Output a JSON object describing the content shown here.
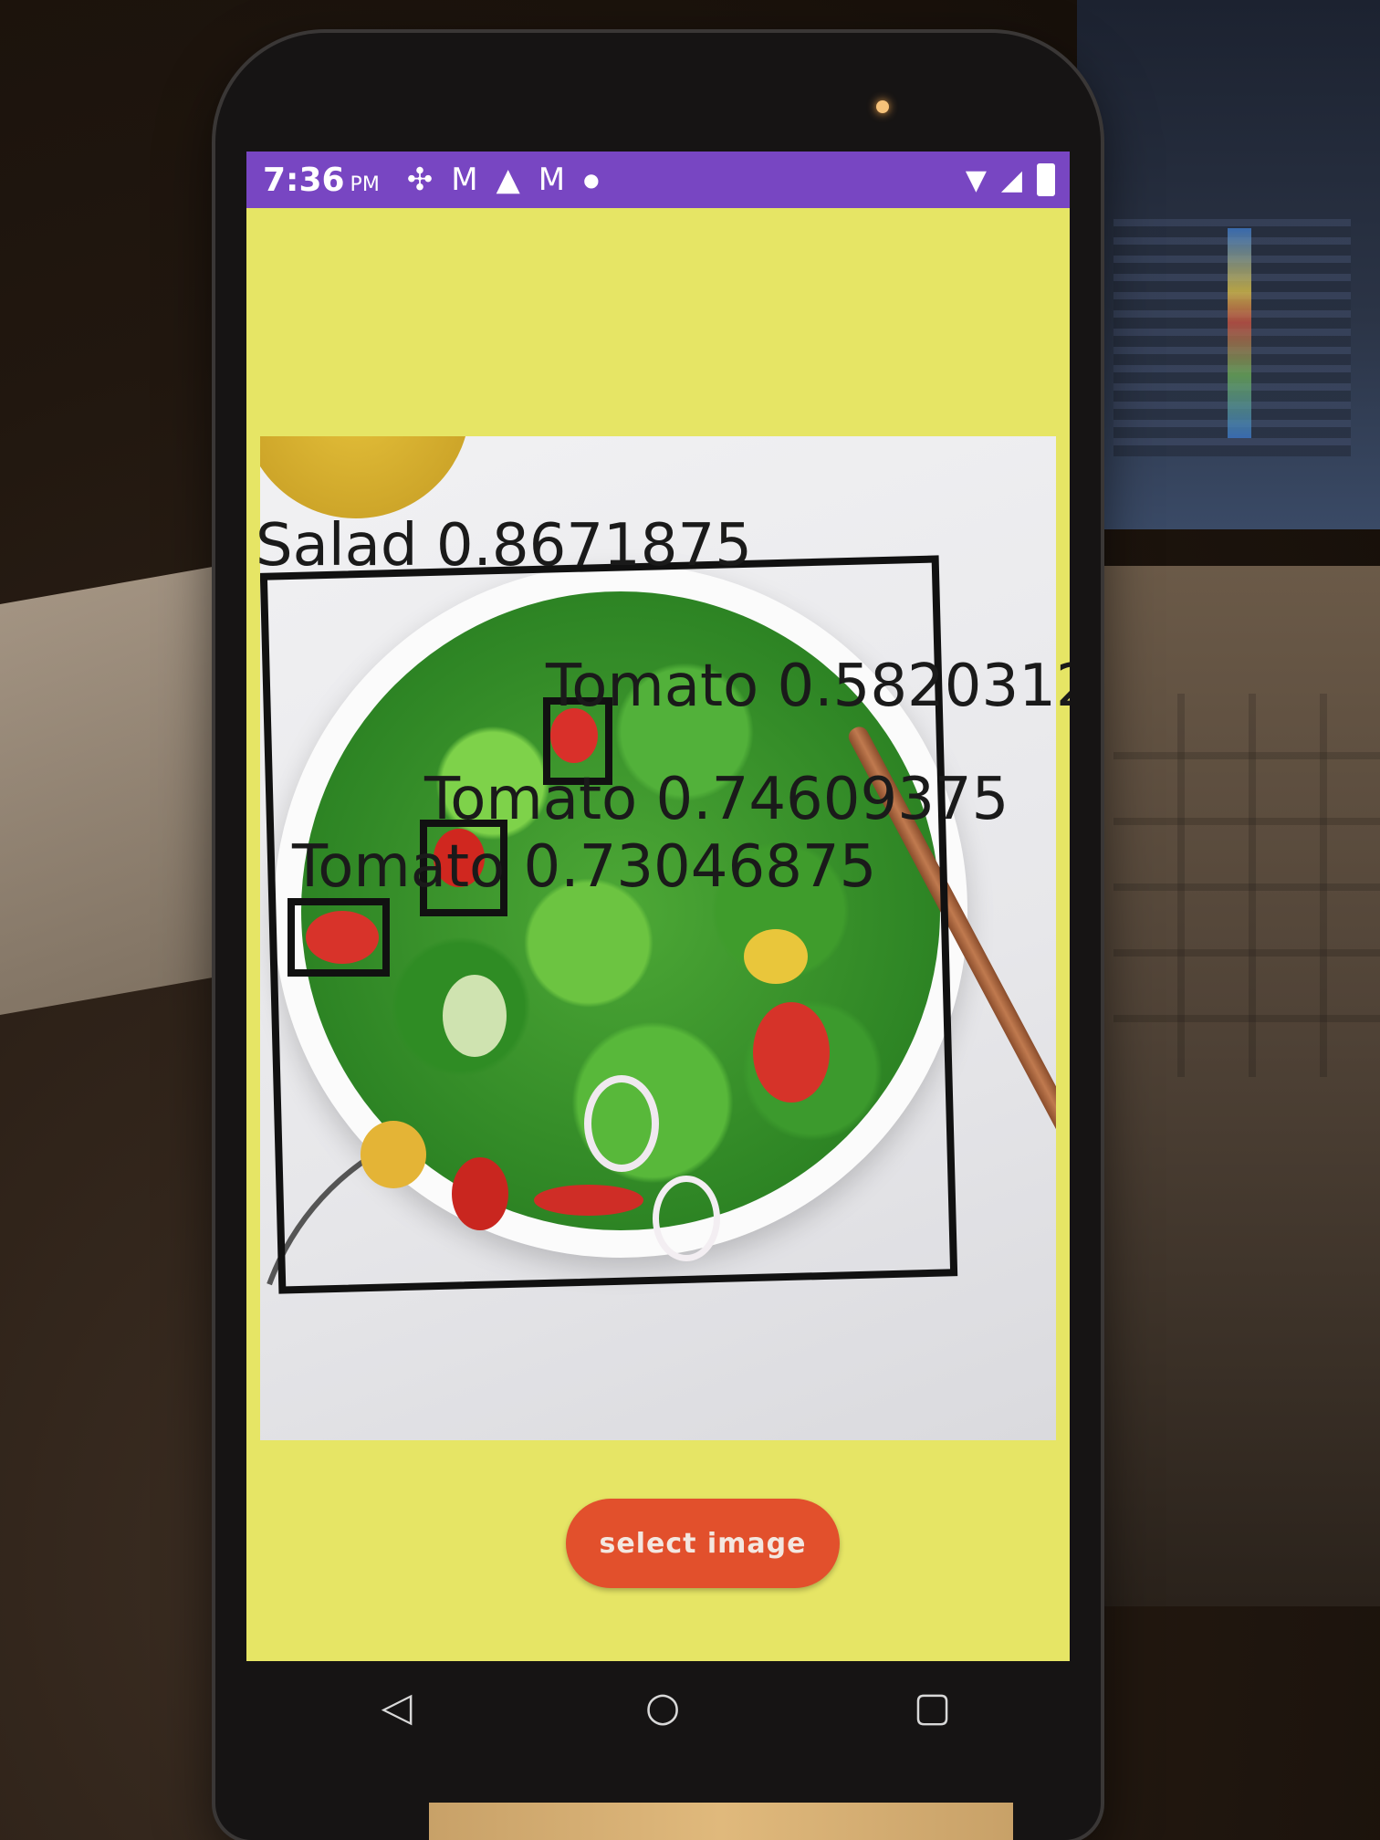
{
  "status_bar": {
    "time": "7:36",
    "ampm": "PM",
    "icons": [
      "pinwheel-icon",
      "gmail-icon",
      "warning-icon",
      "gmail-icon",
      "dot-icon"
    ],
    "right_icons": [
      "wifi-icon",
      "signal-icon",
      "battery-icon"
    ]
  },
  "detections": [
    {
      "label": "Salad 0.8671875"
    },
    {
      "label": "Tomato 0.5820312"
    },
    {
      "label": "Tomato 0.74609375"
    },
    {
      "label": "Tomato 0.73046875"
    }
  ],
  "button": {
    "label": "select image"
  },
  "nav": {
    "back": "◁",
    "home": "○",
    "recents": "▢"
  },
  "colors": {
    "status_bar": "#7846c2",
    "app_background": "#e6e565",
    "button": "#e2502c"
  }
}
